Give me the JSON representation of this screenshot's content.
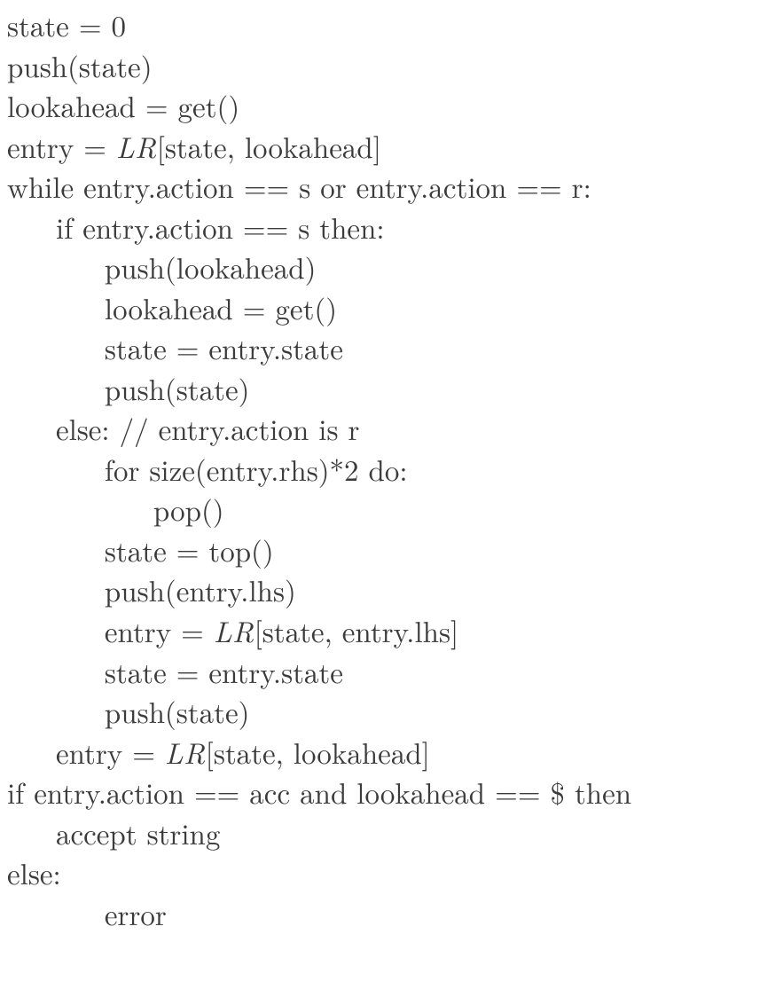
{
  "lines": [
    {
      "indent": 0,
      "segs": [
        {
          "t": "state = 0"
        }
      ]
    },
    {
      "indent": 0,
      "segs": [
        {
          "t": "push(state)"
        }
      ]
    },
    {
      "indent": 0,
      "segs": [
        {
          "t": "lookahead = get()"
        }
      ]
    },
    {
      "indent": 0,
      "segs": [
        {
          "t": "entry = "
        },
        {
          "t": "LR",
          "it": true
        },
        {
          "t": "[state, lookahead]"
        }
      ]
    },
    {
      "indent": 0,
      "segs": [
        {
          "t": "while entry.action == s or entry.action == r:"
        }
      ]
    },
    {
      "indent": 1,
      "segs": [
        {
          "t": "if entry.action == s then:"
        }
      ]
    },
    {
      "indent": 2,
      "segs": [
        {
          "t": "push(lookahead)"
        }
      ]
    },
    {
      "indent": 2,
      "segs": [
        {
          "t": "lookahead = get()"
        }
      ]
    },
    {
      "indent": 2,
      "segs": [
        {
          "t": "state = entry.state"
        }
      ]
    },
    {
      "indent": 2,
      "segs": [
        {
          "t": "push(state)"
        }
      ]
    },
    {
      "indent": 1,
      "segs": [
        {
          "t": "else: // entry.action is r"
        }
      ]
    },
    {
      "indent": 2,
      "segs": [
        {
          "t": "for size(entry.rhs)*2 do:"
        }
      ]
    },
    {
      "indent": 3,
      "segs": [
        {
          "t": "pop()"
        }
      ]
    },
    {
      "indent": 2,
      "segs": [
        {
          "t": "state = top()"
        }
      ]
    },
    {
      "indent": 2,
      "segs": [
        {
          "t": "push(entry.lhs)"
        }
      ]
    },
    {
      "indent": 2,
      "segs": [
        {
          "t": "entry = "
        },
        {
          "t": "LR",
          "it": true
        },
        {
          "t": "[state, entry.lhs]"
        }
      ]
    },
    {
      "indent": 2,
      "segs": [
        {
          "t": "state = entry.state"
        }
      ]
    },
    {
      "indent": 2,
      "segs": [
        {
          "t": "push(state)"
        }
      ]
    },
    {
      "indent": 1,
      "segs": [
        {
          "t": "entry = "
        },
        {
          "t": "LR",
          "it": true
        },
        {
          "t": "[state, lookahead]"
        }
      ]
    },
    {
      "indent": 0,
      "segs": [
        {
          "t": "if entry.action == acc and lookahead == $ then"
        }
      ]
    },
    {
      "indent": 1,
      "segs": [
        {
          "t": "accept string"
        }
      ]
    },
    {
      "indent": 0,
      "segs": [
        {
          "t": "else:"
        }
      ]
    },
    {
      "indent": 2,
      "segs": [
        {
          "t": "error"
        }
      ]
    }
  ],
  "indent_unit": "     "
}
